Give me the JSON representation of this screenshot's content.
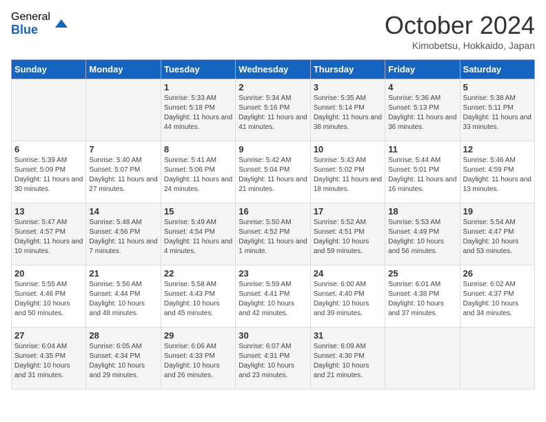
{
  "header": {
    "logo_general": "General",
    "logo_blue": "Blue",
    "title": "October 2024",
    "location": "Kimobetsu, Hokkaido, Japan"
  },
  "days_of_week": [
    "Sunday",
    "Monday",
    "Tuesday",
    "Wednesday",
    "Thursday",
    "Friday",
    "Saturday"
  ],
  "weeks": [
    [
      {
        "day": "",
        "info": ""
      },
      {
        "day": "",
        "info": ""
      },
      {
        "day": "1",
        "info": "Sunrise: 5:33 AM\nSunset: 5:18 PM\nDaylight: 11 hours and 44 minutes."
      },
      {
        "day": "2",
        "info": "Sunrise: 5:34 AM\nSunset: 5:16 PM\nDaylight: 11 hours and 41 minutes."
      },
      {
        "day": "3",
        "info": "Sunrise: 5:35 AM\nSunset: 5:14 PM\nDaylight: 11 hours and 38 minutes."
      },
      {
        "day": "4",
        "info": "Sunrise: 5:36 AM\nSunset: 5:13 PM\nDaylight: 11 hours and 36 minutes."
      },
      {
        "day": "5",
        "info": "Sunrise: 5:38 AM\nSunset: 5:11 PM\nDaylight: 11 hours and 33 minutes."
      }
    ],
    [
      {
        "day": "6",
        "info": "Sunrise: 5:39 AM\nSunset: 5:09 PM\nDaylight: 11 hours and 30 minutes."
      },
      {
        "day": "7",
        "info": "Sunrise: 5:40 AM\nSunset: 5:07 PM\nDaylight: 11 hours and 27 minutes."
      },
      {
        "day": "8",
        "info": "Sunrise: 5:41 AM\nSunset: 5:06 PM\nDaylight: 11 hours and 24 minutes."
      },
      {
        "day": "9",
        "info": "Sunrise: 5:42 AM\nSunset: 5:04 PM\nDaylight: 11 hours and 21 minutes."
      },
      {
        "day": "10",
        "info": "Sunrise: 5:43 AM\nSunset: 5:02 PM\nDaylight: 11 hours and 18 minutes."
      },
      {
        "day": "11",
        "info": "Sunrise: 5:44 AM\nSunset: 5:01 PM\nDaylight: 11 hours and 16 minutes."
      },
      {
        "day": "12",
        "info": "Sunrise: 5:46 AM\nSunset: 4:59 PM\nDaylight: 11 hours and 13 minutes."
      }
    ],
    [
      {
        "day": "13",
        "info": "Sunrise: 5:47 AM\nSunset: 4:57 PM\nDaylight: 11 hours and 10 minutes."
      },
      {
        "day": "14",
        "info": "Sunrise: 5:48 AM\nSunset: 4:56 PM\nDaylight: 11 hours and 7 minutes."
      },
      {
        "day": "15",
        "info": "Sunrise: 5:49 AM\nSunset: 4:54 PM\nDaylight: 11 hours and 4 minutes."
      },
      {
        "day": "16",
        "info": "Sunrise: 5:50 AM\nSunset: 4:52 PM\nDaylight: 11 hours and 1 minute."
      },
      {
        "day": "17",
        "info": "Sunrise: 5:52 AM\nSunset: 4:51 PM\nDaylight: 10 hours and 59 minutes."
      },
      {
        "day": "18",
        "info": "Sunrise: 5:53 AM\nSunset: 4:49 PM\nDaylight: 10 hours and 56 minutes."
      },
      {
        "day": "19",
        "info": "Sunrise: 5:54 AM\nSunset: 4:47 PM\nDaylight: 10 hours and 53 minutes."
      }
    ],
    [
      {
        "day": "20",
        "info": "Sunrise: 5:55 AM\nSunset: 4:46 PM\nDaylight: 10 hours and 50 minutes."
      },
      {
        "day": "21",
        "info": "Sunrise: 5:56 AM\nSunset: 4:44 PM\nDaylight: 10 hours and 48 minutes."
      },
      {
        "day": "22",
        "info": "Sunrise: 5:58 AM\nSunset: 4:43 PM\nDaylight: 10 hours and 45 minutes."
      },
      {
        "day": "23",
        "info": "Sunrise: 5:59 AM\nSunset: 4:41 PM\nDaylight: 10 hours and 42 minutes."
      },
      {
        "day": "24",
        "info": "Sunrise: 6:00 AM\nSunset: 4:40 PM\nDaylight: 10 hours and 39 minutes."
      },
      {
        "day": "25",
        "info": "Sunrise: 6:01 AM\nSunset: 4:38 PM\nDaylight: 10 hours and 37 minutes."
      },
      {
        "day": "26",
        "info": "Sunrise: 6:02 AM\nSunset: 4:37 PM\nDaylight: 10 hours and 34 minutes."
      }
    ],
    [
      {
        "day": "27",
        "info": "Sunrise: 6:04 AM\nSunset: 4:35 PM\nDaylight: 10 hours and 31 minutes."
      },
      {
        "day": "28",
        "info": "Sunrise: 6:05 AM\nSunset: 4:34 PM\nDaylight: 10 hours and 29 minutes."
      },
      {
        "day": "29",
        "info": "Sunrise: 6:06 AM\nSunset: 4:33 PM\nDaylight: 10 hours and 26 minutes."
      },
      {
        "day": "30",
        "info": "Sunrise: 6:07 AM\nSunset: 4:31 PM\nDaylight: 10 hours and 23 minutes."
      },
      {
        "day": "31",
        "info": "Sunrise: 6:09 AM\nSunset: 4:30 PM\nDaylight: 10 hours and 21 minutes."
      },
      {
        "day": "",
        "info": ""
      },
      {
        "day": "",
        "info": ""
      }
    ]
  ]
}
